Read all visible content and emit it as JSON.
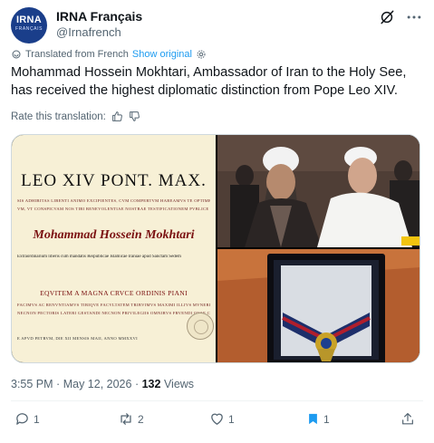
{
  "account": {
    "name": "IRNA Français",
    "handle": "@Irnafrench",
    "avatar_text": "IRNA",
    "avatar_subtext": "FRANÇAIS"
  },
  "translation": {
    "label": "Translated from French",
    "show_original": "Show original",
    "rate_label": "Rate this translation:"
  },
  "tweet_text": "Mohammad Hossein Mokhtari, Ambassador of Iran to the Holy See, has received the highest diplomatic distinction from Pope Leo XIV.",
  "certificate": {
    "title": "LEO XIV PONT. MAX.",
    "line1": "SIS ADHIBITAS LIBENTI ANIMO EXCIPIENTES, CVM COMPERTVM HABEAMVS TE OPTIME DE CATHOLICA RELIGIONE",
    "line2": "VM, VT CONSPICVAM NOS TIBI BENEVOLENTIAE NOSTRAE TESTIFICATIONEM PVBLICE EXHIBEAMVS",
    "recipient": "Mohammad Hossein Mokhtari",
    "line3": "Extraordinarium liberis cum mandatis Reipublicae Islamicae Iraniae apud Sanctam Sedem",
    "order": "EQVITEM A MAGNA CRVCE ORDINIS PIANI",
    "line4": "FACIMVS AC RENVNTIAMVS TIBIQVE FACVLTATEM TRIBVIMVS MAXIMI ILLIVS MVNERIS",
    "line5": "NECNON PECTORIS LATERI GESTANDI NECNON PRIVILEGIIS OMNIBVS FRVENDI QVAE CVM HAC",
    "line6": "E APVD PETRVM, DIE XII MENSIS MAII, ANNO MMXXVI"
  },
  "meta": {
    "time": "3:55 PM",
    "sep1": "·",
    "date": "May 12, 2026",
    "sep2": "·",
    "views_count": "132",
    "views_label": "Views"
  },
  "actions": {
    "replies": "1",
    "reposts": "2",
    "likes": "1",
    "bookmarks": "1"
  },
  "colors": {
    "accent": "#1d9bf0",
    "secondary_text": "#536471"
  }
}
